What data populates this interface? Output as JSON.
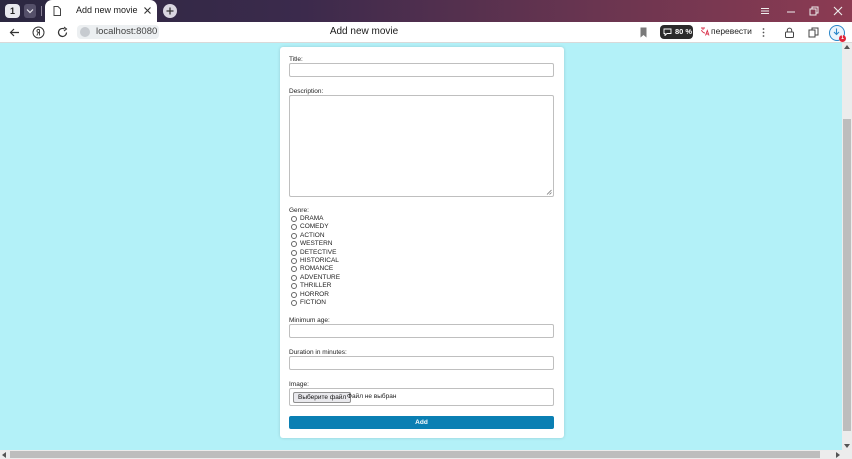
{
  "browser": {
    "tab_count": "1",
    "active_tab_title": "Add new movie",
    "url": "localhost:8080",
    "page_title": "Add new movie",
    "zoom": "80 %",
    "translate_label": "перевести",
    "downloads_badge": "1"
  },
  "form": {
    "title_label": "Title:",
    "title_value": "",
    "description_label": "Description:",
    "description_value": "",
    "genre_label": "Genre:",
    "genres": [
      "DRAMA",
      "COMEDY",
      "ACTION",
      "WESTERN",
      "DETECTIVE",
      "HISTORICAL",
      "ROMANCE",
      "ADVENTURE",
      "THRILLER",
      "HORROR",
      "FICTION"
    ],
    "min_age_label": "Minimum age:",
    "min_age_value": "",
    "duration_label": "Duration in minutes:",
    "duration_value": "",
    "image_label": "Image:",
    "file_button_label": "Выберите файл",
    "file_status": "Файл не выбран",
    "submit_label": "Add"
  },
  "colors": {
    "page_background": "#b3f1f8",
    "submit_button": "#0a7fb3",
    "download_badge": "#e0253a"
  }
}
